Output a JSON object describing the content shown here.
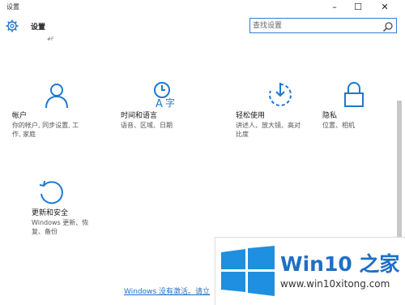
{
  "window": {
    "title": "设置",
    "min_glyph": "–",
    "max_glyph": "☐",
    "close_glyph": "✕"
  },
  "header": {
    "title": "设置",
    "sub_caption": "#F",
    "search_placeholder": "查找设置"
  },
  "tiles": [
    {
      "title": "帐户",
      "desc_lines": [
        "你的帐户, 同步设置, 工",
        "作, 家庭"
      ],
      "icon": "person-icon"
    },
    {
      "title": "时间和语言",
      "desc_lines": [
        "语音、区域、日期"
      ],
      "icon": "time-language-icon"
    },
    {
      "title": "轻松使用",
      "desc_lines": [
        "讲述人、放大镜、高对",
        "比度"
      ],
      "icon": "ease-of-access-icon"
    },
    {
      "title": "隐私",
      "desc_lines": [
        "位置、相机"
      ],
      "icon": "lock-icon"
    },
    {
      "title": "更新和安全",
      "desc_lines": [
        "Windows 更新、恢",
        "复、备份"
      ],
      "icon": "update-icon"
    }
  ],
  "activation": {
    "text": "Windows 没有激活。请立"
  },
  "watermark": {
    "name": "Win10 之家",
    "url": "www.win10xitong.com"
  },
  "colors": {
    "accent": "#1f78d1",
    "watermark_blue": "#1f6fc5"
  }
}
